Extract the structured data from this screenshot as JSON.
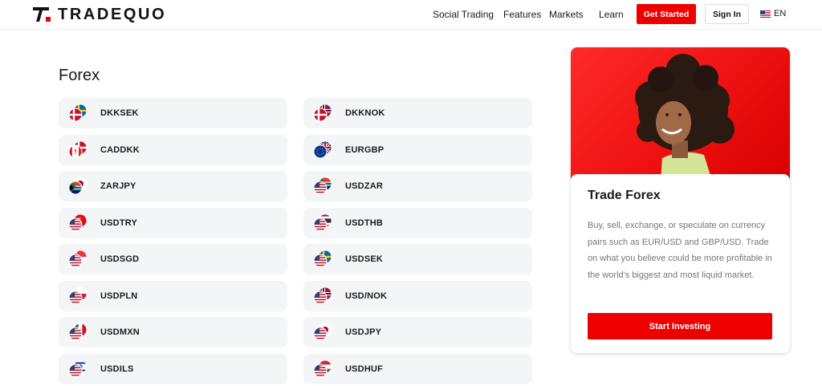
{
  "header": {
    "logo_text": "TRADEQUO",
    "nav": [
      {
        "label": "Social Trading"
      },
      {
        "label": "Features"
      },
      {
        "label": "Markets"
      },
      {
        "label": "Learn"
      }
    ],
    "get_started_label": "Get Started",
    "sign_in_label": "Sign In",
    "language_label": "EN",
    "language_flag_icon": "us-flag-icon"
  },
  "main": {
    "title": "Forex",
    "pairs_left": [
      {
        "label": "DKKSEK",
        "icon": "dk-se-flags-icon"
      },
      {
        "label": "CADDKK",
        "icon": "ca-dk-flags-icon"
      },
      {
        "label": "ZARJPY",
        "icon": "za-jp-flags-icon"
      },
      {
        "label": "USDTRY",
        "icon": "us-tr-flags-icon"
      },
      {
        "label": "USDSGD",
        "icon": "us-sg-flags-icon"
      },
      {
        "label": "USDPLN",
        "icon": "us-pl-flags-icon"
      },
      {
        "label": "USDMXN",
        "icon": "us-mx-flags-icon"
      },
      {
        "label": "USDILS",
        "icon": "us-il-flags-icon"
      }
    ],
    "pairs_right": [
      {
        "label": "DKKNOK",
        "icon": "dk-no-flags-icon"
      },
      {
        "label": "EURGBP",
        "icon": "eu-gb-flags-icon"
      },
      {
        "label": "USDZAR",
        "icon": "us-za-flags-icon"
      },
      {
        "label": "USDTHB",
        "icon": "us-th-flags-icon"
      },
      {
        "label": "USDSEK",
        "icon": "us-se-flags-icon"
      },
      {
        "label": "USD/NOK",
        "icon": "us-no-flags-icon"
      },
      {
        "label": "USDJPY",
        "icon": "us-jp-flags-icon"
      },
      {
        "label": "USDHUF",
        "icon": "us-hu-flags-icon"
      }
    ]
  },
  "promo": {
    "title": "Trade Forex",
    "text": "Buy, sell, exchange, or speculate on currency pairs such as EUR/USD and GBP/USD. Trade on what you believe could be more profitable in the world's biggest and most liquid market.",
    "button_label": "Start Investing"
  },
  "colors": {
    "brand_red": "#ee0000",
    "pair_bg": "#f4f5f6"
  }
}
